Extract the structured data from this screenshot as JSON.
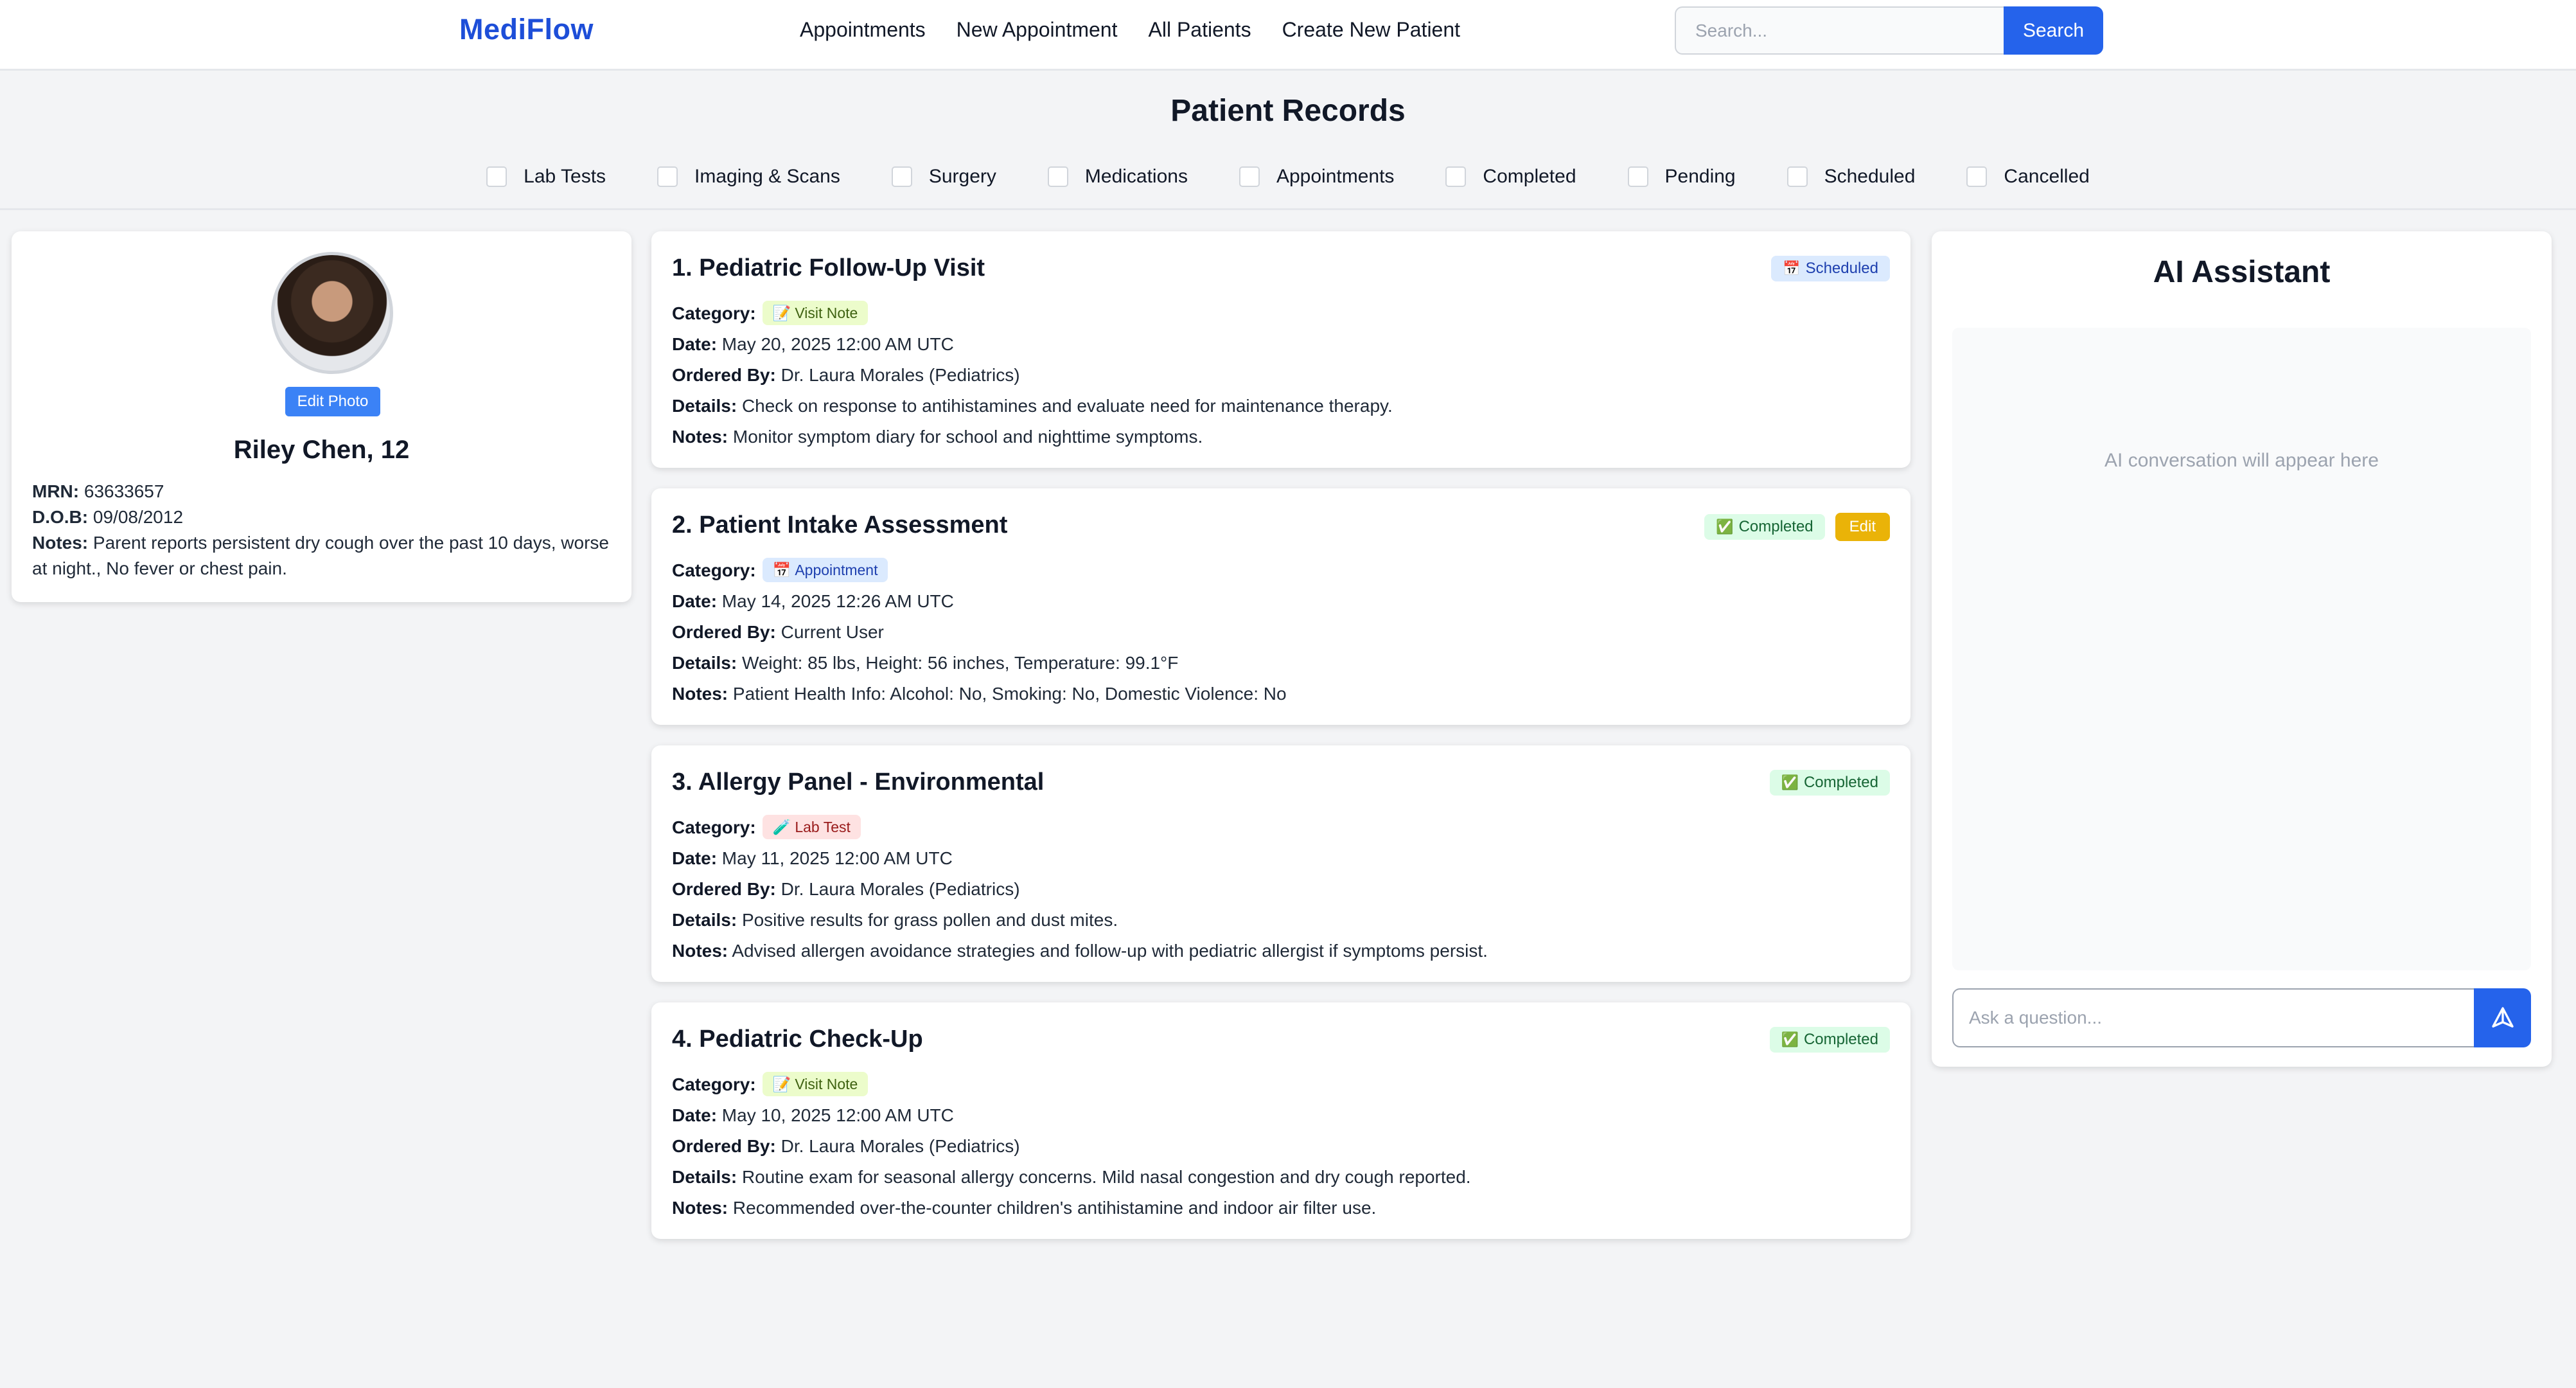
{
  "brand": "MediFlow",
  "nav": [
    "Appointments",
    "New Appointment",
    "All Patients",
    "Create New Patient"
  ],
  "search": {
    "placeholder": "Search...",
    "button": "Search"
  },
  "page_title": "Patient Records",
  "filters": [
    "Lab Tests",
    "Imaging & Scans",
    "Surgery",
    "Medications",
    "Appointments",
    "Completed",
    "Pending",
    "Scheduled",
    "Cancelled"
  ],
  "patient": {
    "edit_photo": "Edit Photo",
    "name": "Riley Chen, 12",
    "mrn_label": "MRN:",
    "mrn": "63633657",
    "dob_label": "D.O.B:",
    "dob": "09/08/2012",
    "notes_label": "Notes:",
    "notes": "Parent reports persistent dry cough over the past 10 days, worse at night., No fever or chest pain."
  },
  "labels": {
    "category": "Category:",
    "date": "Date:",
    "ordered_by": "Ordered By:",
    "details": "Details:",
    "notes": "Notes:"
  },
  "records": [
    {
      "title": "1. Pediatric Follow-Up Visit",
      "status": "Scheduled",
      "status_icon": "📅",
      "category": "Visit Note",
      "category_icon": "📝",
      "date": "May 20, 2025 12:00 AM UTC",
      "ordered_by": "Dr. Laura Morales (Pediatrics)",
      "details": "Check on response to antihistamines and evaluate need for maintenance therapy.",
      "notes": "Monitor symptom diary for school and nighttime symptoms."
    },
    {
      "title": "2. Patient Intake Assessment",
      "status": "Completed",
      "status_icon": "✅",
      "edit": "Edit",
      "category": "Appointment",
      "category_icon": "📅",
      "date": "May 14, 2025 12:26 AM UTC",
      "ordered_by": "Current User",
      "details": "Weight: 85 lbs, Height: 56 inches, Temperature: 99.1°F",
      "notes": "Patient Health Info: Alcohol: No, Smoking: No, Domestic Violence: No"
    },
    {
      "title": "3. Allergy Panel - Environmental",
      "status": "Completed",
      "status_icon": "✅",
      "category": "Lab Test",
      "category_icon": "🧪",
      "date": "May 11, 2025 12:00 AM UTC",
      "ordered_by": "Dr. Laura Morales (Pediatrics)",
      "details": "Positive results for grass pollen and dust mites.",
      "notes": "Advised allergen avoidance strategies and follow-up with pediatric allergist if symptoms persist."
    },
    {
      "title": "4. Pediatric Check-Up",
      "status": "Completed",
      "status_icon": "✅",
      "category": "Visit Note",
      "category_icon": "📝",
      "date": "May 10, 2025 12:00 AM UTC",
      "ordered_by": "Dr. Laura Morales (Pediatrics)",
      "details": "Routine exam for seasonal allergy concerns. Mild nasal congestion and dry cough reported.",
      "notes": "Recommended over-the-counter children's antihistamine and indoor air filter use."
    }
  ],
  "ai": {
    "title": "AI Assistant",
    "placeholder_text": "AI conversation will appear here",
    "input_placeholder": "Ask a question..."
  }
}
